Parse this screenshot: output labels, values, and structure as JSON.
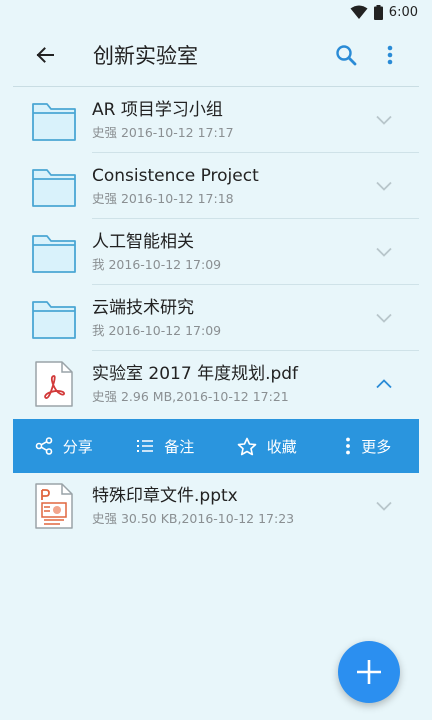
{
  "status_bar": {
    "time": "6:00"
  },
  "app_bar": {
    "title": "创新实验室"
  },
  "files": [
    {
      "name": "AR 项目学习小组",
      "meta": "史强 2016-10-12 17:17",
      "type": "folder",
      "expanded": false
    },
    {
      "name": "Consistence Project",
      "meta": "史强 2016-10-12 17:18",
      "type": "folder",
      "expanded": false
    },
    {
      "name": "人工智能相关",
      "meta": "我 2016-10-12 17:09",
      "type": "folder",
      "expanded": false
    },
    {
      "name": "云端技术研究",
      "meta": "我 2016-10-12 17:09",
      "type": "folder",
      "expanded": false
    },
    {
      "name": "实验室 2017 年度规划.pdf",
      "meta": "史强 2.96 MB,2016-10-12 17:21",
      "type": "pdf",
      "expanded": true
    },
    {
      "name": "特殊印章文件.pptx",
      "meta": "史强 30.50 KB,2016-10-12 17:23",
      "type": "pptx",
      "expanded": false
    }
  ],
  "actions": {
    "share": "分享",
    "note": "备注",
    "favorite": "收藏",
    "more": "更多"
  },
  "colors": {
    "background": "#e8f6fa",
    "accent": "#2a95de",
    "fab": "#2b8ff0",
    "folder_stroke": "#4aa6d4"
  }
}
